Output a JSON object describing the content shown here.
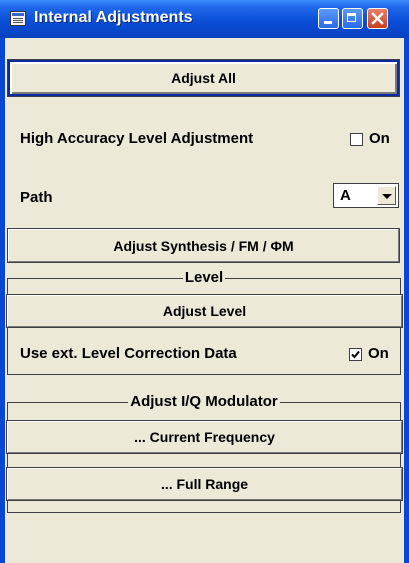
{
  "window": {
    "title": "Internal Adjustments"
  },
  "main": {
    "adjust_all_label": "Adjust All",
    "high_accuracy_label": "High Accuracy Level Adjustment",
    "high_accuracy_checkbox": {
      "label": "On",
      "checked": false
    },
    "path_label": "Path",
    "path_select_value": "A",
    "adjust_synthesis_label": "Adjust Synthesis / FM / ΦM"
  },
  "level_group": {
    "title": "Level",
    "adjust_level_label": "Adjust Level",
    "ext_correction_label": "Use ext. Level Correction Data",
    "ext_correction_checkbox": {
      "label": "On",
      "checked": true
    }
  },
  "iq_group": {
    "title": "Adjust I/Q Modulator",
    "current_frequency_label": "... Current Frequency",
    "full_range_label": "... Full Range"
  }
}
